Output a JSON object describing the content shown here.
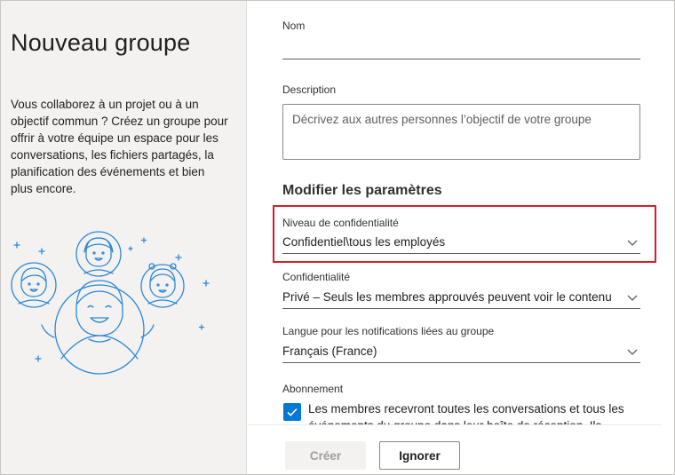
{
  "left": {
    "title": "Nouveau groupe",
    "description": "Vous collaborez à un projet ou à un objectif commun ? Créez un groupe pour offrir à votre équipe un espace pour les conversations, les fichiers partagés, la planification des événements et bien plus encore."
  },
  "form": {
    "name_label": "Nom",
    "name_value": "",
    "description_label": "Description",
    "description_placeholder": "Décrivez aux autres personnes l’objectif de votre groupe",
    "settings_title": "Modifier les paramètres",
    "sensitivity_label": "Niveau de confidentialité",
    "sensitivity_value": "Confidentiel\\tous les employés",
    "privacy_label": "Confidentialité",
    "privacy_value": "Privé – Seuls les membres approuvés peuvent voir le contenu",
    "language_label": "Langue pour les notifications liées au groupe",
    "language_value": "Français (France)",
    "subscription_label": "Abonnement",
    "subscription_checked": true,
    "subscription_text": "Les membres recevront toutes les conversations et tous les événements du groupe dans leur boîte de réception. Ils"
  },
  "buttons": {
    "create": "Créer",
    "ignore": "Ignorer"
  },
  "colors": {
    "accent": "#0078d4",
    "highlight_border": "#d1202d",
    "left_panel_bg": "#f3f2f1"
  },
  "icons": [
    "people-group-illustration",
    "chevron-down-icon",
    "checkmark-icon"
  ]
}
